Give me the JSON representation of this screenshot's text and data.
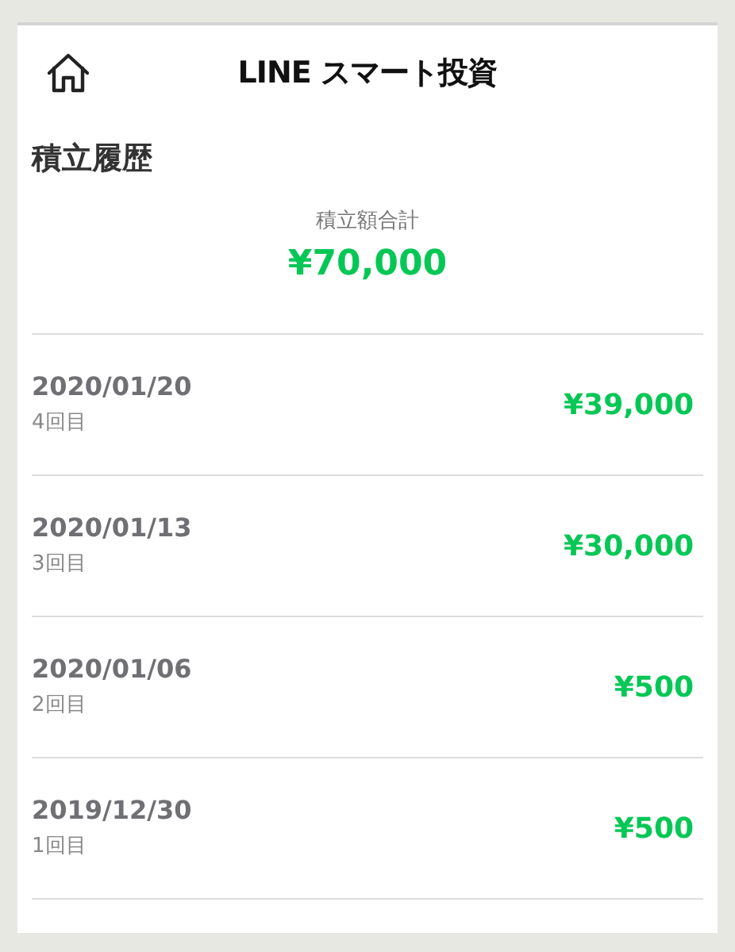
{
  "header": {
    "title": "LINE スマート投資"
  },
  "page_title": "積立履歴",
  "summary": {
    "label": "積立額合計",
    "amount": "¥70,000"
  },
  "history": [
    {
      "date": "2020/01/20",
      "count": "4回目",
      "amount": "¥39,000"
    },
    {
      "date": "2020/01/13",
      "count": "3回目",
      "amount": "¥30,000"
    },
    {
      "date": "2020/01/06",
      "count": "2回目",
      "amount": "¥500"
    },
    {
      "date": "2019/12/30",
      "count": "1回目",
      "amount": "¥500"
    }
  ]
}
